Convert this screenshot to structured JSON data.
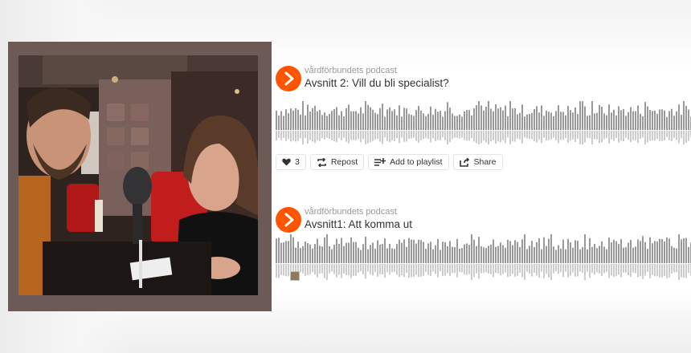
{
  "colors": {
    "accent": "#ff5500",
    "wave_top": "#999999",
    "wave_bottom": "#cccccc",
    "frame": "#6b5a55"
  },
  "photo": {
    "description_icon": "podcast-photo"
  },
  "tracks": [
    {
      "uploader": "vårdförbundets podcast",
      "title": "Avsnitt 2: Vill du bli specialist?",
      "actions": {
        "like_count": "3",
        "repost_label": "Repost",
        "playlist_label": "Add to playlist",
        "share_label": "Share"
      }
    },
    {
      "uploader": "vårdförbundets podcast",
      "title": "Avsnitt1: Att komma ut"
    }
  ]
}
